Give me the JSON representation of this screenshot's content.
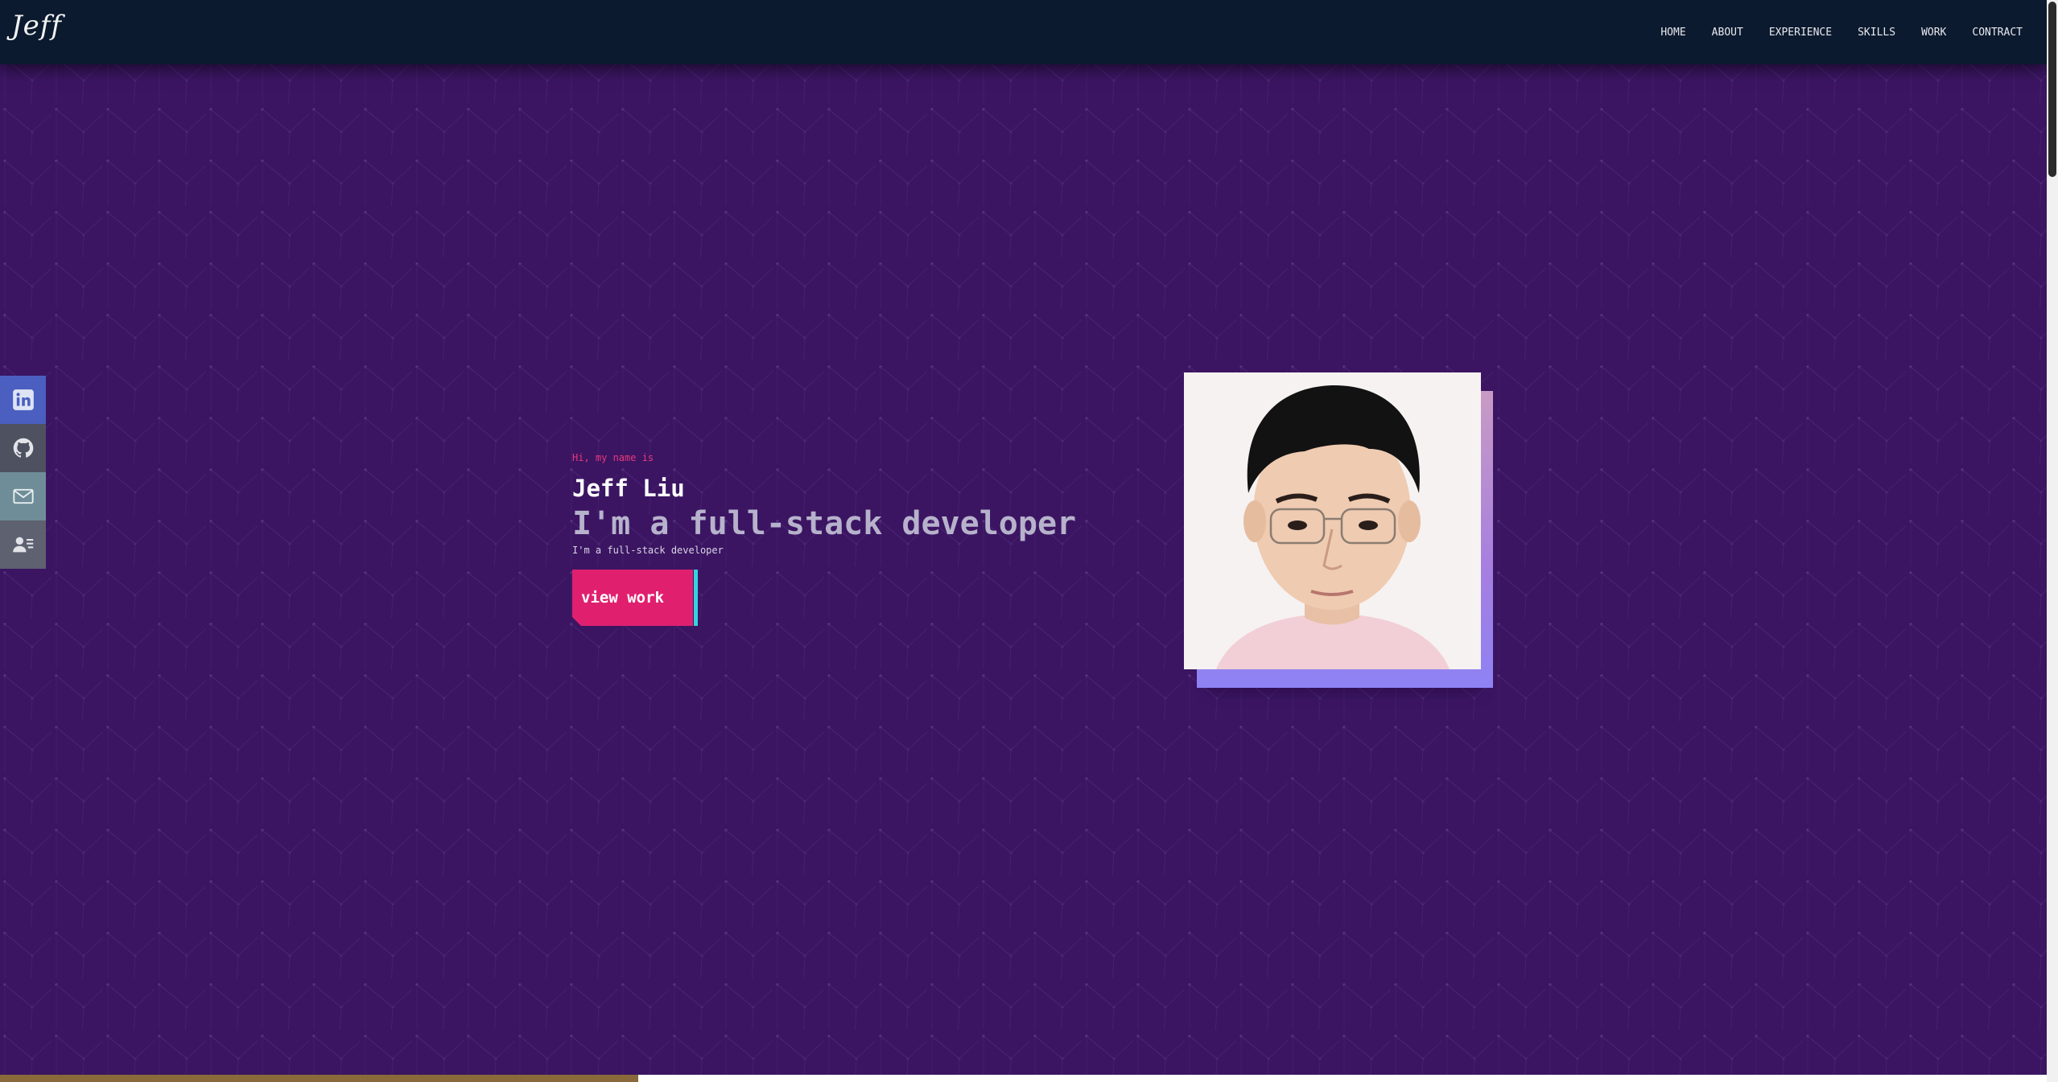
{
  "header": {
    "logo": "Jeff",
    "nav": [
      {
        "label": "HOME"
      },
      {
        "label": "ABOUT"
      },
      {
        "label": "EXPERIENCE"
      },
      {
        "label": "SKILLS"
      },
      {
        "label": "WORK"
      },
      {
        "label": "CONTRACT"
      }
    ]
  },
  "social": [
    {
      "icon": "linkedin-icon",
      "color": "#4a5fbf"
    },
    {
      "icon": "github-icon",
      "color": "#4e5160"
    },
    {
      "icon": "mail-icon",
      "color": "#6e8d98"
    },
    {
      "icon": "resume-icon",
      "color": "#5d6170"
    }
  ],
  "hero": {
    "greeting": "Hi, my name is",
    "name": "Jeff Liu",
    "headline": "I'm a full-stack developer",
    "subline": "I'm a full-stack developer",
    "cta_label": "view work"
  },
  "colors": {
    "background": "#3b1562",
    "navbar": "#0b1a2e",
    "accent_pink": "#e0206f",
    "accent_cyan": "#35d3e0"
  }
}
